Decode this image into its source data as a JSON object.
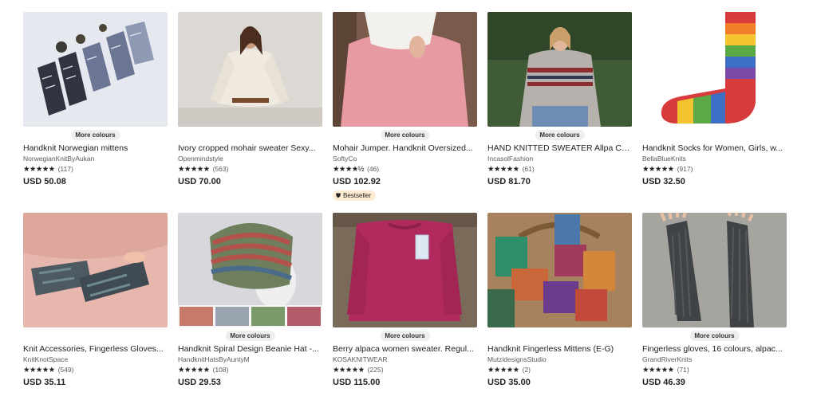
{
  "listings": [
    {
      "pill": "More colours",
      "title": "Handknit Norwegian mittens",
      "shop": "NorwegianKnitByAukan",
      "stars": "★★★★★",
      "count": "(117)",
      "price": "USD 50.08",
      "image": "mittens-norwegian",
      "badge": ""
    },
    {
      "pill": "",
      "title": "Ivory cropped mohair sweater Sexy...",
      "shop": "Openmindstyle",
      "stars": "★★★★★",
      "count": "(563)",
      "price": "USD 70.00",
      "image": "ivory-sweater",
      "badge": ""
    },
    {
      "pill": "More colours",
      "title": "Mohair Jumper. Handknit Oversized...",
      "shop": "SoftyCo",
      "stars": "★★★★½",
      "count": "(46)",
      "price": "USD 102.92",
      "image": "pink-mohair",
      "badge": "Bestseller"
    },
    {
      "pill": "More colours",
      "title": "HAND KNITTED SWEATER Allpa Co...",
      "shop": "IncasolFashion",
      "stars": "★★★★★",
      "count": "(61)",
      "price": "USD 81.70",
      "image": "allpa-sweater",
      "badge": ""
    },
    {
      "pill": "",
      "title": "Handknit Socks for Women, Girls, w...",
      "shop": "BellaBlueKnits",
      "stars": "★★★★★",
      "count": "(917)",
      "price": "USD 32.50",
      "image": "rainbow-sock",
      "badge": ""
    },
    {
      "pill": "",
      "title": "Knit Accessories, Fingerless Gloves...",
      "shop": "KnitKnotSpace",
      "stars": "★★★★★",
      "count": "(549)",
      "price": "USD 35.11",
      "image": "fingerless-gloves-grey",
      "badge": ""
    },
    {
      "pill": "More colours",
      "title": "Handknit Spiral Design Beanie Hat -...",
      "shop": "HandknitHatsByAuntyM",
      "stars": "★★★★★",
      "count": "(108)",
      "price": "USD 29.53",
      "image": "spiral-beanie",
      "badge": ""
    },
    {
      "pill": "More colours",
      "title": "Berry alpaca women sweater. Regul...",
      "shop": "KOSAKNITWEAR",
      "stars": "★★★★★",
      "count": "(225)",
      "price": "USD 115.00",
      "image": "berry-sweater",
      "badge": ""
    },
    {
      "pill": "",
      "title": "Handknit Fingerless Mittens (E-G)",
      "shop": "MutzidesignsStudio",
      "stars": "★★★★★",
      "count": "(2)",
      "price": "USD 35.00",
      "image": "mittens-basket",
      "badge": ""
    },
    {
      "pill": "More colours",
      "title": "Fingerless gloves, 16 colours, alpac...",
      "shop": "GrandRiverKnits",
      "stars": "★★★★★",
      "count": "(71)",
      "price": "USD 46.39",
      "image": "long-fingerless-gloves",
      "badge": ""
    }
  ],
  "colors": {
    "badge_bg": "#fdebd2",
    "pill_bg": "#eeeeee",
    "text": "#222222",
    "muted": "#595959"
  }
}
